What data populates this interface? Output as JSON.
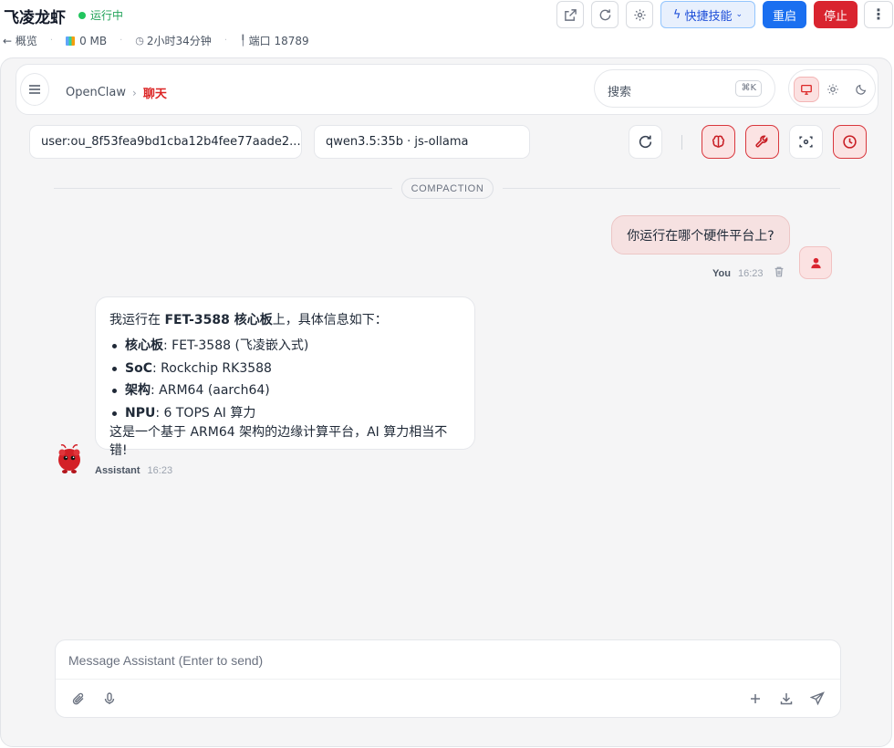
{
  "header": {
    "title": "飞凌龙虾",
    "status": "运行中",
    "back_label": "← 概览",
    "memory": "0 MB",
    "uptime": "2小时34分钟",
    "port": "端口 18789",
    "skills_label": "快捷技能",
    "restart_label": "重启",
    "stop_label": "停止"
  },
  "topbar": {
    "breadcrumb_root": "OpenClaw",
    "breadcrumb_current": "聊天",
    "search_placeholder": "搜索",
    "search_shortcut": "⌘K"
  },
  "session": {
    "user_id": "user:ou_8f53fea9bd1cba12b4fee77aade2...",
    "model": "qwen3.5:35b · js-ollama"
  },
  "chat": {
    "divider_label": "COMPACTION",
    "user_message": {
      "text": "你运行在哪个硬件平台上?",
      "sender": "You",
      "time": "16:23"
    },
    "assistant_message": {
      "intro_prefix": "我运行在 ",
      "intro_bold": "FET-3588 核心板",
      "intro_suffix": "上，具体信息如下：",
      "items": [
        {
          "key": "核心板",
          "value": ": FET-3588 (飞凌嵌入式)"
        },
        {
          "key": "SoC",
          "value": ": Rockchip RK3588"
        },
        {
          "key": "架构",
          "value": ": ARM64 (aarch64)"
        },
        {
          "key": "NPU",
          "value": ": 6 TOPS AI 算力"
        }
      ],
      "outro": "这是一个基于 ARM64 架构的边缘计算平台，AI 算力相当不错!",
      "sender": "Assistant",
      "time": "16:23"
    }
  },
  "composer": {
    "placeholder": "Message Assistant (Enter to send)"
  },
  "colors": {
    "accent_red": "#d9242f",
    "primary_blue": "#1a6ff0",
    "status_green": "#22c55e"
  }
}
